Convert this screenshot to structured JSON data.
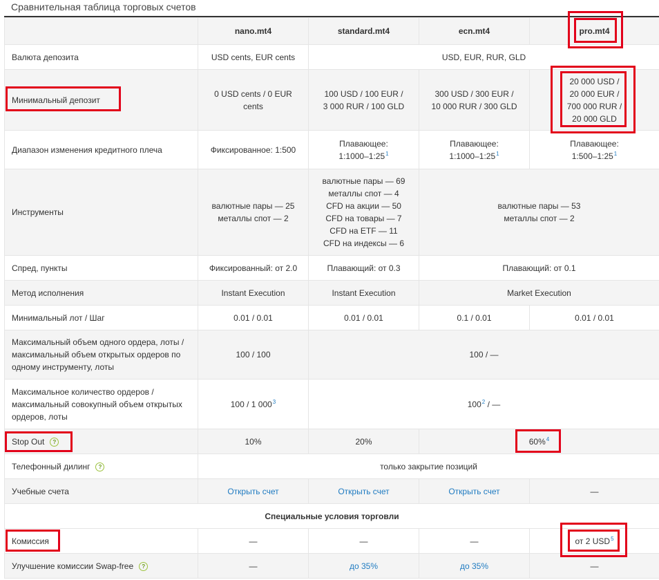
{
  "page_title": "Сравнительная таблица торговых счетов",
  "columns": [
    "nano.mt4",
    "standard.mt4",
    "ecn.mt4",
    "pro.mt4"
  ],
  "rows": {
    "currency": {
      "label": "Валюта депозита",
      "nano": "USD cents, EUR cents",
      "rest": "USD, EUR, RUR, GLD"
    },
    "min_deposit": {
      "label": "Минимальный депозит",
      "nano": [
        "0 USD cents / 0 EUR",
        "cents"
      ],
      "standard": [
        "100 USD / 100 EUR /",
        "3 000 RUR / 100 GLD"
      ],
      "ecn": [
        "300 USD / 300 EUR /",
        "10 000 RUR / 300 GLD"
      ],
      "pro": [
        "20 000 USD /",
        "20 000 EUR /",
        "700 000 RUR /",
        "20 000 GLD"
      ]
    },
    "leverage": {
      "label": "Диапазон изменения кредитного плеча",
      "nano": "Фиксированное: 1:500",
      "standard": [
        "Плавающее:",
        "1:1000–1:25"
      ],
      "ecn": [
        "Плавающее:",
        "1:1000–1:25"
      ],
      "pro": [
        "Плавающее:",
        "1:500–1:25"
      ],
      "footnote": "1"
    },
    "instruments": {
      "label": "Инструменты",
      "nano": [
        "валютные пары — 25",
        "металлы спот — 2"
      ],
      "standard": [
        "валютные пары — 69",
        "металлы спот — 4",
        "CFD на акции — 50",
        "CFD на товары — 7",
        "CFD на ETF — 11",
        "CFD на индексы — 6"
      ],
      "ecn_pro": [
        "валютные пары — 53",
        "металлы спот — 2"
      ]
    },
    "spread": {
      "label": "Спред, пункты",
      "nano": "Фиксированный: от 2.0",
      "standard": "Плавающий: от 0.3",
      "ecn_pro": "Плавающий: от 0.1"
    },
    "execution": {
      "label": "Метод исполнения",
      "nano": "Instant Execution",
      "standard": "Instant Execution",
      "ecn_pro": "Market Execution"
    },
    "min_lot": {
      "label": "Минимальный лот / Шаг",
      "nano": "0.01 / 0.01",
      "standard": "0.01 / 0.01",
      "ecn": "0.1 / 0.01",
      "pro": "0.01 / 0.01"
    },
    "max_volume": {
      "label": [
        "Максимальный объем одного ордера, лоты /",
        "максимальный объем открытых ордеров по",
        "одному инструменту, лоты"
      ],
      "nano": "100 / 100",
      "rest": "100 / —"
    },
    "max_orders": {
      "label": [
        "Максимальное количество ордеров /",
        "максимальный совокупный объем открытых",
        "ордеров, лоты"
      ],
      "nano": "100 / 1 000",
      "nano_footnote": "3",
      "rest_a": "100",
      "rest_footnote": "2",
      "rest_b": "/ —"
    },
    "stop_out": {
      "label": "Stop Out",
      "nano": "10%",
      "standard": "20%",
      "ecn_pro": "60%",
      "footnote": "4"
    },
    "phone": {
      "label": "Телефонный дилинг",
      "value": "только закрытие позиций"
    },
    "demo": {
      "label": "Учебные счета",
      "link": "Открыть счет",
      "pro": "—"
    },
    "special_header": "Специальные условия торговли",
    "commission": {
      "label": "Комиссия",
      "nano": "—",
      "standard": "—",
      "ecn": "—",
      "pro": "от 2 USD",
      "footnote": "5"
    },
    "swap_free": {
      "label": "Улучшение комиссии Swap-free",
      "nano": "—",
      "standard": "до 35%",
      "ecn": "до 35%",
      "pro": "—"
    }
  },
  "help_glyph": "?",
  "highlight_color": "#e2001a",
  "link_color": "#1f7bc1"
}
